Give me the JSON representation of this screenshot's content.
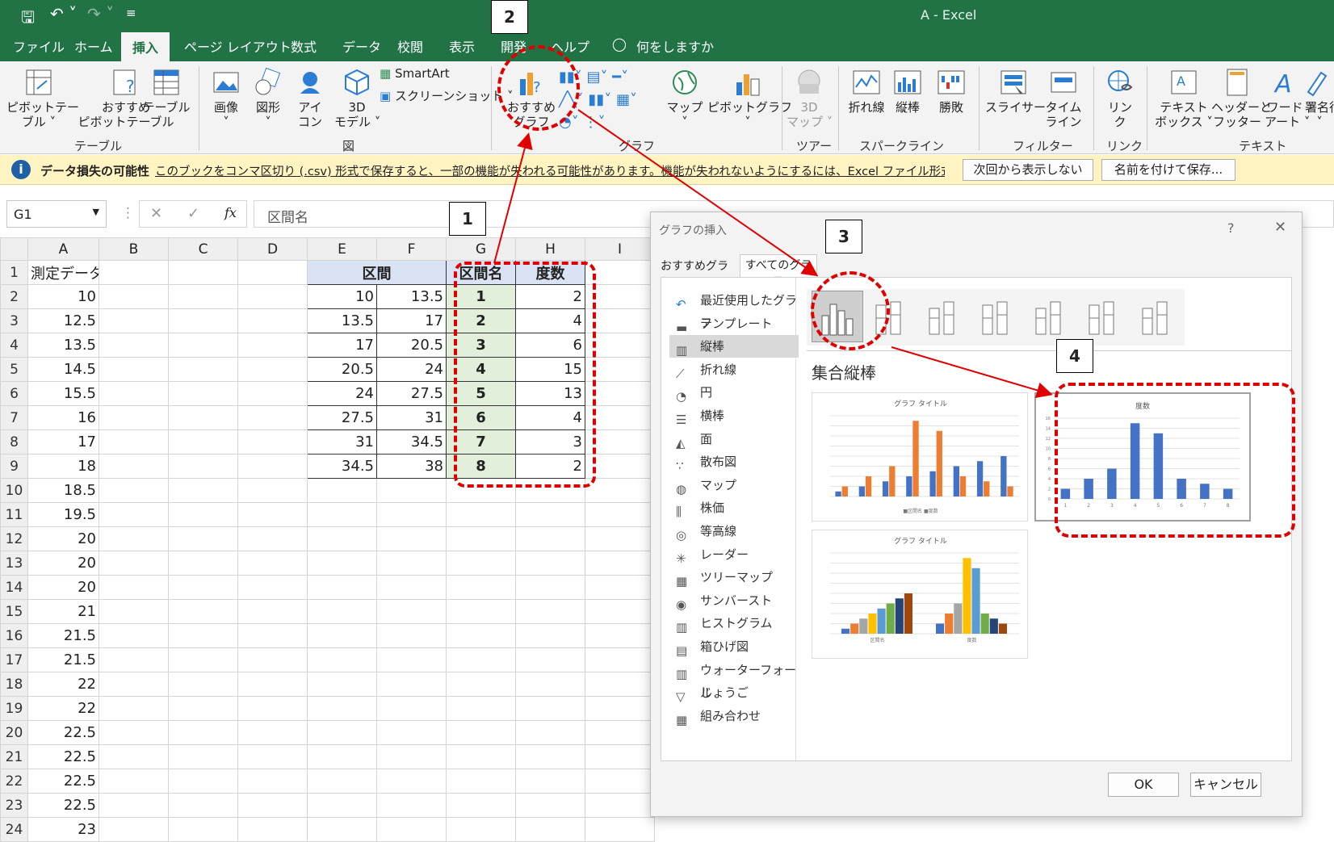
{
  "title_bar": {
    "title": "A  -  Excel"
  },
  "menu": [
    "ファイル",
    "ホーム",
    "挿入",
    "ページ レイアウト",
    "数式",
    "データ",
    "校閲",
    "表示",
    "開発",
    "ヘルプ",
    "何をしますか"
  ],
  "ribbon": {
    "buttons": [
      "ピボットテー\nブル ˅",
      "おすすめ\nピボットテーブル",
      "テーブル",
      "画像\n˅",
      "図形\n˅",
      "アイ\nコン",
      "3D\nモデル ˅",
      "おすすめ\nグラフ",
      "マップ\n˅",
      "ピボットグラフ\n˅",
      "3D\nマップ ˅",
      "折れ線",
      "縦棒",
      "勝敗",
      "スライサー",
      "タイム\nライン",
      "リン\nク",
      "テキスト\nボックス ˅",
      "ヘッダーと\nフッター",
      "ワード\nアート ˅",
      "署名行\n˅"
    ],
    "smartart": "SmartArt",
    "screenshot": "スクリーンショット ˅",
    "groups": [
      "テーブル",
      "図",
      "グラフ",
      "ツアー",
      "スパークライン",
      "フィルター",
      "リンク",
      "テキスト"
    ]
  },
  "infobar": {
    "title": "データ損失の可能性",
    "message": "このブックをコンマ区切り (.csv) 形式で保存すると、一部の機能が失われる可能性があります。機能が失われないようにするには、Excel ファイル形式で保存してください。",
    "btn_dismiss": "次回から表示しない",
    "btn_saveas": "名前を付けて保存..."
  },
  "formula": {
    "namebox": "G1",
    "fx": "fx",
    "content": "区間名"
  },
  "sheet": {
    "cols": [
      "A",
      "B",
      "C",
      "D",
      "E",
      "F",
      "G",
      "H",
      "I"
    ],
    "rows": [
      [
        "測定データ",
        "",
        "",
        "",
        "区間",
        "",
        "区間名",
        "度数"
      ],
      [
        "10",
        "",
        "",
        "",
        "10",
        "13.5",
        "1",
        "2"
      ],
      [
        "12.5",
        "",
        "",
        "",
        "13.5",
        "17",
        "2",
        "4"
      ],
      [
        "13.5",
        "",
        "",
        "",
        "17",
        "20.5",
        "3",
        "6"
      ],
      [
        "14.5",
        "",
        "",
        "",
        "20.5",
        "24",
        "4",
        "15"
      ],
      [
        "15.5",
        "",
        "",
        "",
        "24",
        "27.5",
        "5",
        "13"
      ],
      [
        "16",
        "",
        "",
        "",
        "27.5",
        "31",
        "6",
        "4"
      ],
      [
        "17",
        "",
        "",
        "",
        "31",
        "34.5",
        "7",
        "3"
      ],
      [
        "18",
        "",
        "",
        "",
        "34.5",
        "38",
        "8",
        "2"
      ],
      [
        "18.5"
      ],
      [
        "19.5"
      ],
      [
        "20"
      ],
      [
        "20"
      ],
      [
        "20"
      ],
      [
        "21"
      ],
      [
        "21.5"
      ],
      [
        "21.5"
      ],
      [
        "22"
      ],
      [
        "22"
      ],
      [
        "22.5"
      ],
      [
        "22.5"
      ],
      [
        "22.5"
      ],
      [
        "22.5"
      ],
      [
        "23"
      ]
    ]
  },
  "dialog": {
    "title": "グラフの挿入",
    "help": "?",
    "close": "✕",
    "tabs": [
      "おすすめグラフ",
      "すべてのグラフ"
    ],
    "categories": [
      "最近使用したグラフ",
      "テンプレート",
      "縦棒",
      "折れ線",
      "円",
      "横棒",
      "面",
      "散布図",
      "マップ",
      "株価",
      "等高線",
      "レーダー",
      "ツリーマップ",
      "サンバースト",
      "ヒストグラム",
      "箱ひげ図",
      "ウォーターフォール",
      "じょうご",
      "組み合わせ"
    ],
    "subtype_name": "集合縦棒",
    "ok": "OK",
    "cancel": "キャンセル",
    "preview1": {
      "title": "グラフ タイトル",
      "legend": "■区間名 ■度数"
    },
    "preview2": {
      "title": "度数"
    },
    "preview3": {
      "title": "グラフ タイトル",
      "cats": [
        "区間名",
        "度数"
      ]
    }
  },
  "annotations": [
    "1",
    "2",
    "3",
    "4"
  ],
  "chart_data": {
    "type": "bar",
    "title": "度数",
    "categories": [
      "1",
      "2",
      "3",
      "4",
      "5",
      "6",
      "7",
      "8"
    ],
    "values": [
      2,
      4,
      6,
      15,
      13,
      4,
      3,
      2
    ],
    "ylim": [
      0,
      16
    ]
  }
}
